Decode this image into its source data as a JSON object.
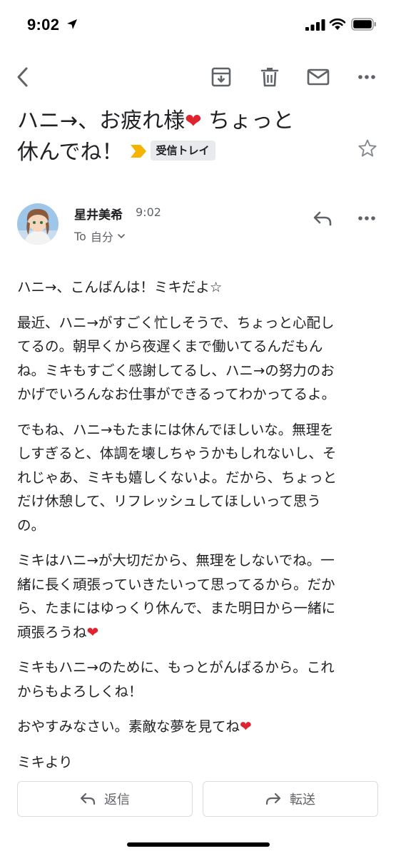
{
  "status_bar": {
    "time": "9:02"
  },
  "icons": {
    "back": "back-arrow-icon",
    "archive": "archive-icon",
    "delete": "trash-icon",
    "mark_unread": "mail-icon",
    "more": "more-horizontal-icon",
    "star": "star-icon",
    "reply": "reply-icon",
    "forward": "forward-icon",
    "importance": "importance-marker-icon"
  },
  "colors": {
    "importance_marker": "#f4b400",
    "heart": "#e0242f",
    "label_bg": "#e8eaed"
  },
  "subject": {
    "line1_text": "ハニ→、お疲れ様",
    "line1_heart": "❤",
    "line1_after": " ちょっと",
    "line2_text": "休んでね！",
    "label": "受信トレイ"
  },
  "sender": {
    "name": "星井美希",
    "time": "9:02",
    "to_prefix": "To",
    "recipient": "自分"
  },
  "body": {
    "p1": "ハニ→、こんばんは！ミキだよ☆",
    "p2": [
      "最近、ハニ→がすごく忙しそうで、ちょっと心配し",
      "てるの。朝早くから夜遅くまで働いてるんだもん",
      "ね。ミキもすごく感謝してるし、ハニ→の努力のお",
      "かげでいろんなお仕事ができるってわかってるよ。"
    ],
    "p3": [
      "でもね、ハニ→もたまには休んでほしいな。無理を",
      "しすぎると、体調を壊しちゃうかもしれないし、そ",
      "れじゃあ、ミキも嬉しくないよ。だから、ちょっと",
      "だけ休憩して、リフレッシュしてほしいって思う",
      "の。"
    ],
    "p4": [
      "ミキはハニ→が大切だから、無理をしないでね。一",
      "緒に長く頑張っていきたいって思ってるから。だか",
      "ら、たまにはゆっくり休んで、また明日から一緒に"
    ],
    "p4_last": "頑張ろうね",
    "p4_heart": "❤",
    "p5": [
      "ミキもハニ→のために、もっとがんばるから。これ",
      "からもよろしくね！"
    ],
    "p6": "おやすみなさい。素敵な夢を見てね",
    "p6_heart": "❤",
    "p7": "ミキより"
  },
  "actions": {
    "reply_label": "返信",
    "forward_label": "転送"
  }
}
